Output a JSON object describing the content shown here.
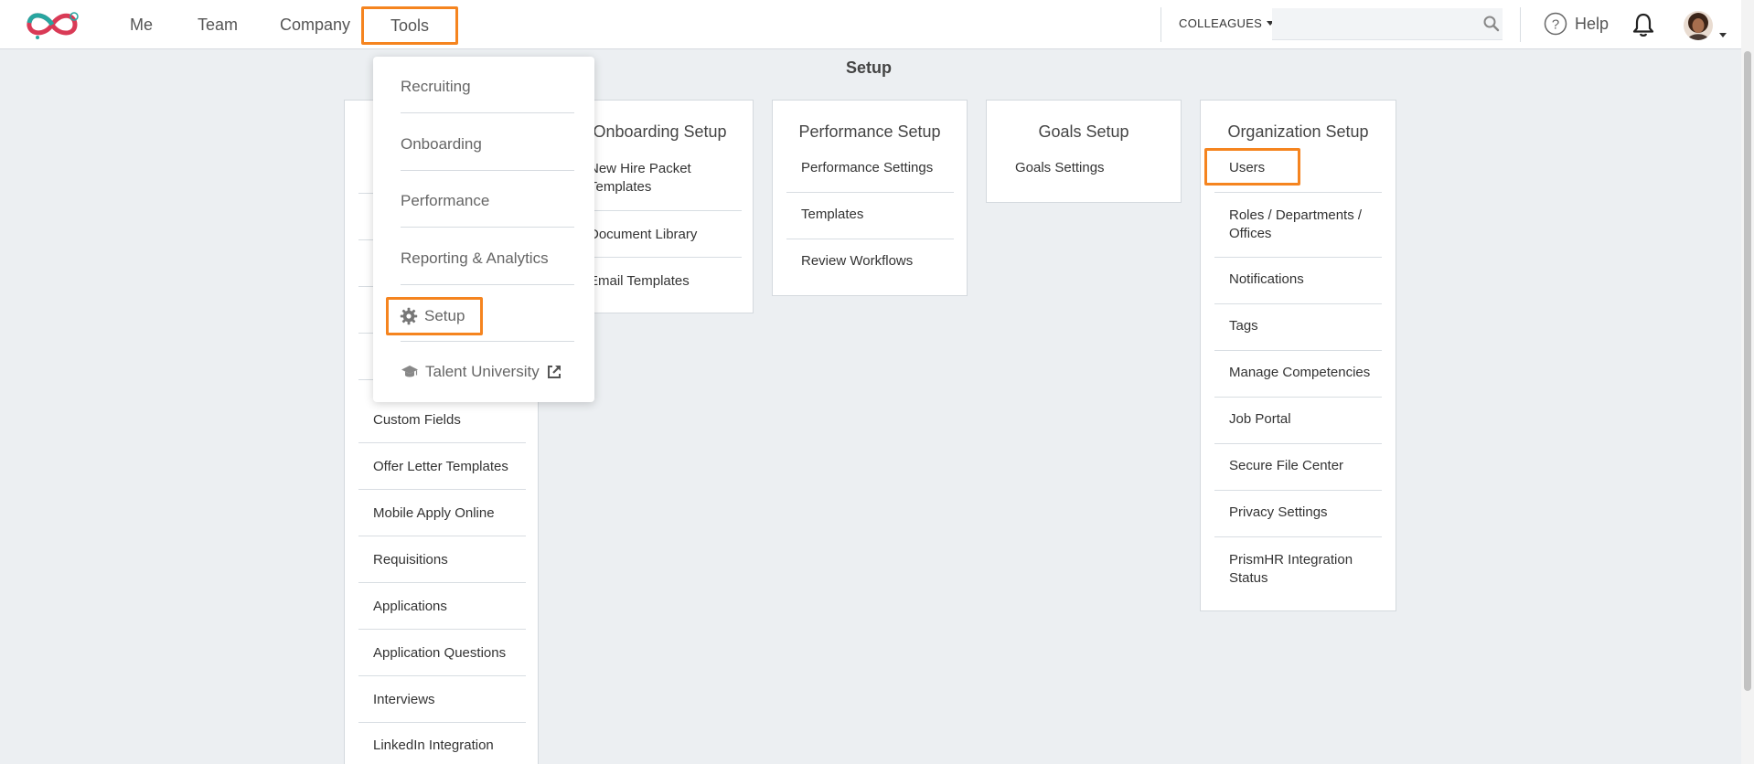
{
  "header": {
    "nav": [
      "Me",
      "Team",
      "Company",
      "Tools"
    ],
    "colleagues_label": "COLLEAGUES",
    "search": {
      "placeholder": "",
      "value": ""
    },
    "help_label": "Help"
  },
  "page": {
    "title": "Setup"
  },
  "tools_menu": {
    "items": [
      "Recruiting",
      "Onboarding",
      "Performance",
      "Reporting & Analytics",
      "Setup",
      "Talent University"
    ]
  },
  "recruiting_card": {
    "items": [
      "Custom Fields",
      "Offer Letter Templates",
      "Mobile Apply Online",
      "Requisitions",
      "Applications",
      "Application Questions",
      "Interviews",
      "LinkedIn Integration"
    ]
  },
  "onboarding_card": {
    "title": "Onboarding Setup",
    "items": [
      [
        "New Hire Packet",
        "Templates"
      ],
      "Document Library",
      "Email Templates"
    ]
  },
  "performance_card": {
    "title": "Performance Setup",
    "items": [
      "Performance Settings",
      "Templates",
      "Review Workflows"
    ]
  },
  "goals_card": {
    "title": "Goals Setup",
    "items": [
      "Goals Settings"
    ]
  },
  "organization_card": {
    "title": "Organization Setup",
    "items": [
      "Users",
      [
        "Roles / Departments /",
        "Offices"
      ],
      "Notifications",
      "Tags",
      "Manage Competencies",
      "Job Portal",
      "Secure File Center",
      "Privacy Settings",
      [
        "PrismHR Integration",
        "Status"
      ]
    ]
  },
  "colors": {
    "highlight": "#f5841f",
    "background": "#eceff2"
  }
}
